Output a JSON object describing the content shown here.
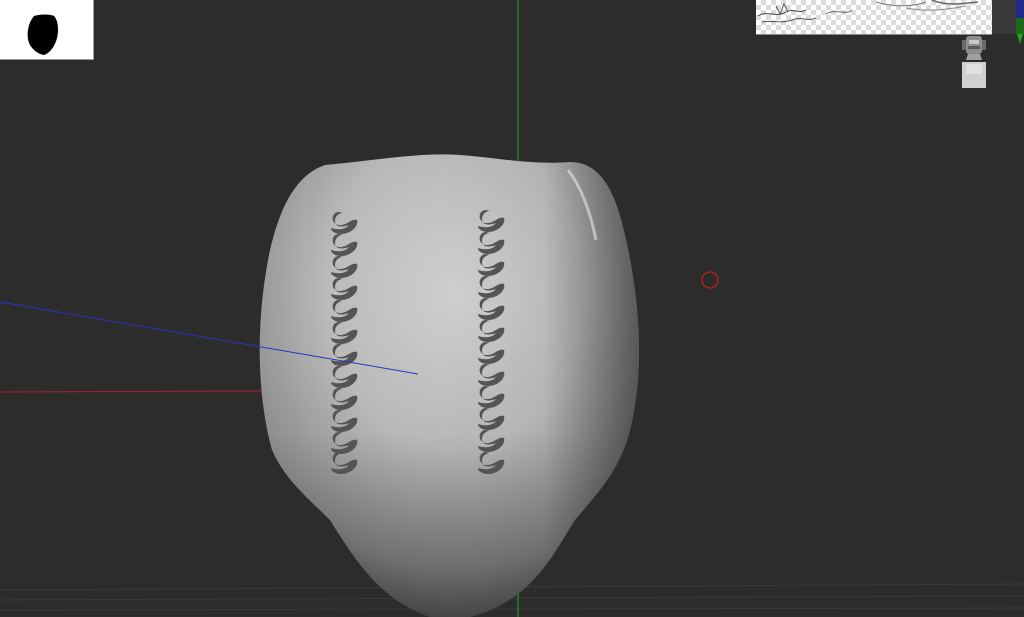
{
  "app": {
    "viewport": "3d-sculpt-viewport"
  },
  "colors": {
    "background": "#2c2c2c",
    "axis_x": "#b02020",
    "axis_y": "#20b020",
    "axis_z": "#3030c0",
    "mesh_light": "#d2d2d2",
    "mesh_dark": "#555555",
    "pattern": "#555555",
    "transpose_marker": "#c02020"
  },
  "icons": {
    "silhouette": "silhouette-icon",
    "reference": "reference-image-icon",
    "gizmo": "head-gizmo-icon",
    "transpose_marker": "circle-marker-icon"
  }
}
